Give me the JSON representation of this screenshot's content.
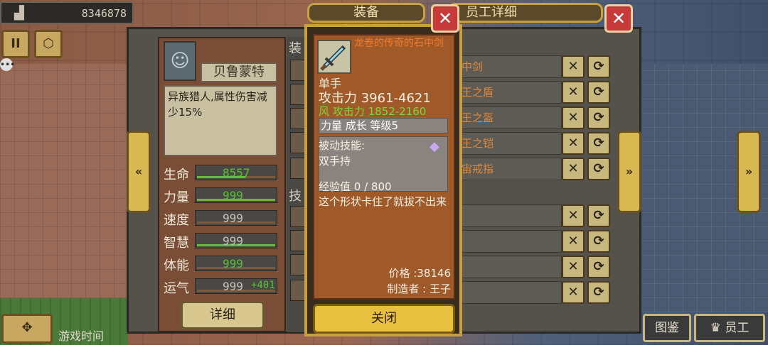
{
  "top_bar": {
    "money_icon": "chart-bar-icon",
    "money_value": "8346878"
  },
  "left_buttons": {
    "pause_label": "II",
    "group_icon": "coins-icon"
  },
  "character": {
    "name": "贝鲁蒙特",
    "description": "异族猎人,属性伤害减少15%",
    "stats": [
      {
        "label": "生命",
        "value": "8557",
        "green": true,
        "fill": 0.62,
        "bonus": ""
      },
      {
        "label": "力量",
        "value": "999",
        "green": true,
        "fill": 1.0,
        "bonus": ""
      },
      {
        "label": "速度",
        "value": "999",
        "green": false,
        "fill": 0.0,
        "bonus": ""
      },
      {
        "label": "智慧",
        "value": "999",
        "green": false,
        "fill": 1.0,
        "bonus": ""
      },
      {
        "label": "体能",
        "value": "999",
        "green": true,
        "fill": 0.0,
        "bonus": ""
      },
      {
        "label": "运气",
        "value": "999",
        "green": false,
        "fill": 0.0,
        "bonus": "+401"
      }
    ],
    "detail_button": "详细"
  },
  "middle_column": {
    "equip_label": "装",
    "skill_label": "技"
  },
  "equipment_list": [
    {
      "name": "中剑"
    },
    {
      "name": "王之盾"
    },
    {
      "name": "王之盔"
    },
    {
      "name": "王之铠"
    },
    {
      "name": "宙戒指"
    }
  ],
  "skill_list": [
    {
      "name": ""
    },
    {
      "name": ""
    },
    {
      "name": ""
    },
    {
      "name": ""
    }
  ],
  "headers": {
    "equip_tab": "装备",
    "staff_detail_tab": "员工详细"
  },
  "item_popup": {
    "name": "龙卷的传奇的石中剑",
    "hand_type": "单手",
    "attack": "攻击力 3961-4621",
    "element_label": "风",
    "element_attack": "攻击力 1852-2160",
    "growth": "力量 成长 等级5",
    "passive_title": "被动技能:",
    "passive_skill": "双手持",
    "exp_label": "经验值",
    "exp_value": "0 / 800",
    "flavor": "这个形状卡住了就拔不出来",
    "price_label": "价格",
    "price_value": "38146",
    "maker_label": "制造者",
    "maker_value": "王子",
    "close_label": "关闭"
  },
  "bottom": {
    "game_time": "游戏时间",
    "collection_label": "图鉴",
    "staff_label": "员工"
  }
}
